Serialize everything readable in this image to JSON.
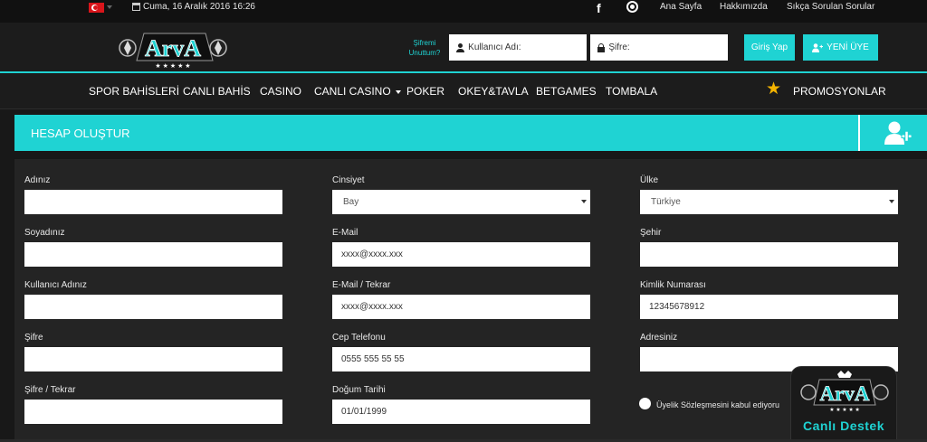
{
  "topbar": {
    "datetime": "Cuma, 16 Aralık 2016 16:26",
    "links": [
      "Ana Sayfa",
      "Hakkımızda",
      "Sıkça Sorulan Sorular"
    ],
    "language_flag": "turkey-flag",
    "social_icons": [
      "facebook-icon",
      "whatsapp-icon"
    ]
  },
  "header": {
    "logo_text": "ArvA",
    "forgot_password": "Şifremi Unuttum?",
    "username_placeholder": "Kullanıcı Adı:",
    "password_placeholder": "Şifre:",
    "login_label": "Giriş Yap",
    "register_label": "YENİ ÜYE"
  },
  "nav": {
    "items": [
      "SPOR BAHİSLERİ",
      "CANLI BAHİS",
      "CASINO",
      "CANLI CASINO",
      "POKER",
      "OKEY&TAVLA",
      "BETGAMES",
      "TOMBALA"
    ],
    "promotions": "PROMOSYONLAR"
  },
  "section": {
    "title": "HESAP OLUŞTUR"
  },
  "form": {
    "col1": [
      {
        "label": "Adınız",
        "value": ""
      },
      {
        "label": "Soyadınız",
        "value": ""
      },
      {
        "label": "Kullanıcı Adınız",
        "value": ""
      },
      {
        "label": "Şifre",
        "value": ""
      },
      {
        "label": "Şifre / Tekrar",
        "value": ""
      }
    ],
    "col2": [
      {
        "label": "Cinsiyet",
        "value": "Bay"
      },
      {
        "label": "E-Mail",
        "value": "xxxx@xxxx.xxx"
      },
      {
        "label": "E-Mail / Tekrar",
        "value": "xxxx@xxxx.xxx"
      },
      {
        "label": "Cep Telefonu",
        "value": "0555 555 55 55"
      },
      {
        "label": "Doğum Tarihi",
        "value": "01/01/1999"
      }
    ],
    "col3": [
      {
        "label": "Ülke",
        "value": "Türkiye"
      },
      {
        "label": "Şehir",
        "value": ""
      },
      {
        "label": "Kimlik Numarası",
        "value": "12345678912"
      },
      {
        "label": "Adresiniz",
        "value": ""
      }
    ],
    "agreement": "Üyelik Sözleşmesini kabul ediyoru"
  },
  "support": {
    "logo_text": "ArvA",
    "label": "Canlı Destek"
  },
  "colors": {
    "accent": "#1fd3d3",
    "background": "#181818",
    "star": "#f5b400"
  }
}
